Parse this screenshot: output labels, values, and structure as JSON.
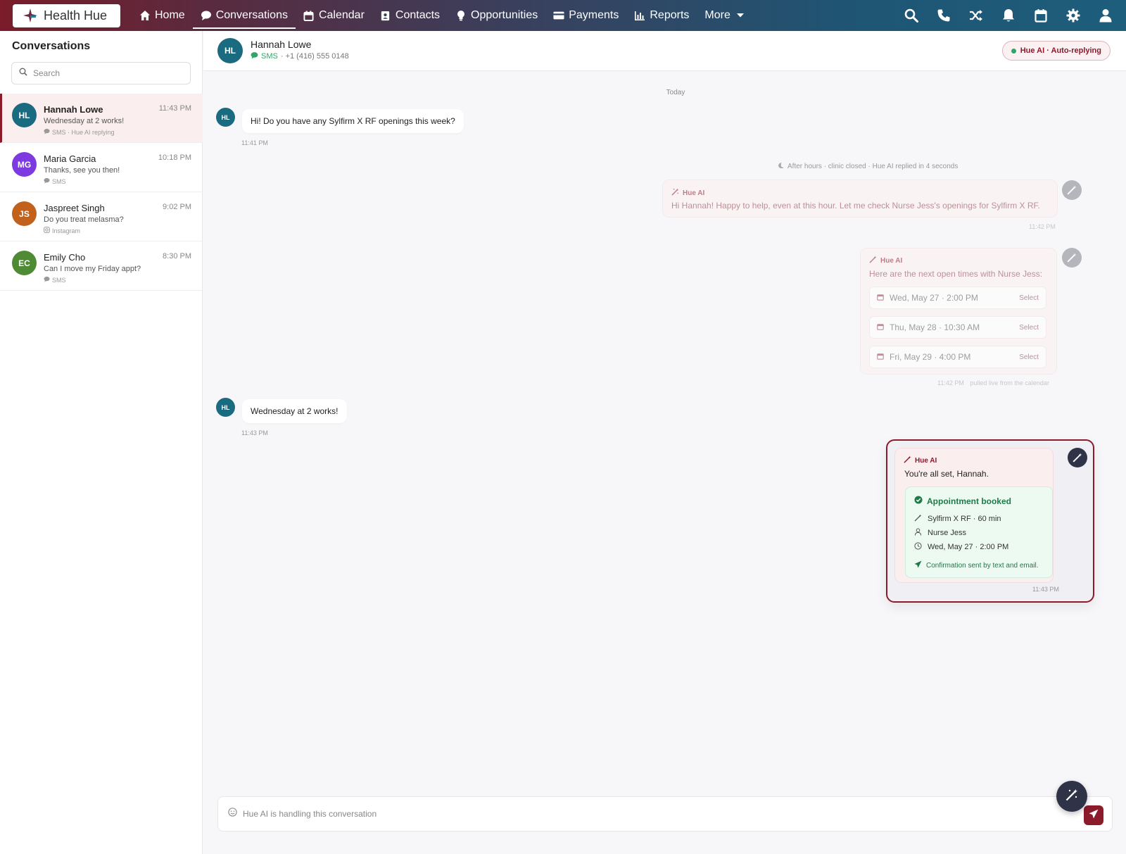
{
  "brand": {
    "name": "Health Hue"
  },
  "nav": {
    "items": [
      {
        "label": "Home",
        "icon": "home-icon",
        "active": false
      },
      {
        "label": "Conversations",
        "icon": "chat-bubble-icon",
        "active": true
      },
      {
        "label": "Calendar",
        "icon": "calendar-icon",
        "active": false
      },
      {
        "label": "Contacts",
        "icon": "contact-card-icon",
        "active": false
      },
      {
        "label": "Opportunities",
        "icon": "lightbulb-icon",
        "active": false
      },
      {
        "label": "Payments",
        "icon": "credit-card-icon",
        "active": false
      },
      {
        "label": "Reports",
        "icon": "bar-chart-icon",
        "active": false
      },
      {
        "label": "More",
        "icon": "chevron-down-icon",
        "active": false
      }
    ],
    "right_icons": [
      "search-icon",
      "phone-icon",
      "shuffle-icon",
      "bell-icon",
      "calendar-icon",
      "gear-icon",
      "user-icon"
    ]
  },
  "sidebar": {
    "title": "Conversations",
    "search_placeholder": "Search",
    "conversations": [
      {
        "initials": "HL",
        "name": "Hannah Lowe",
        "time": "11:43 PM",
        "preview": "Wednesday at 2 works!",
        "meta": "SMS · Hue AI replying",
        "color": "#1a6a80",
        "active": true
      },
      {
        "initials": "MG",
        "name": "Maria Garcia",
        "time": "10:18 PM",
        "preview": "Thanks, see you then!",
        "meta": "SMS",
        "color": "#7c3ae0",
        "active": false
      },
      {
        "initials": "JS",
        "name": "Jaspreet Singh",
        "time": "9:02 PM",
        "preview": "Do you treat melasma?",
        "meta": "Instagram",
        "color": "#c2611b",
        "active": false
      },
      {
        "initials": "EC",
        "name": "Emily Cho",
        "time": "8:30 PM",
        "preview": "Can I move my Friday appt?",
        "meta": "SMS",
        "color": "#4f8a35",
        "active": false
      }
    ]
  },
  "chat": {
    "contact_initials": "HL",
    "contact_name": "Hannah Lowe",
    "channel": "SMS",
    "phone": "· +1 (416) 555 0148",
    "ai_status": "Hue AI · Auto-replying",
    "day_label": "Today",
    "msg1": {
      "text": "Hi! Do you have any Sylfirm X RF openings this week?",
      "time": "11:41 PM"
    },
    "system_note": "After hours · clinic closed · Hue AI replied in 4 seconds",
    "ai1": {
      "label": "Hue AI",
      "text": "Hi Hannah! Happy to help, even at this hour. Let me check Nurse Jess's openings for Sylfirm X RF.",
      "time": "11:42 PM"
    },
    "ai2": {
      "label": "Hue AI",
      "text": "Here are the next open times with Nurse Jess:",
      "slots": [
        {
          "text": "Wed, May 27 · 2:00 PM",
          "action": "Select"
        },
        {
          "text": "Thu, May 28 · 10:30 AM",
          "action": "Select"
        },
        {
          "text": "Fri, May 29 · 4:00 PM",
          "action": "Select"
        }
      ],
      "time": "11:42 PM",
      "footnote": "pulled live from the calendar"
    },
    "msg2": {
      "text": "Wednesday at 2 works!",
      "time": "11:43 PM"
    },
    "ai3": {
      "label": "Hue AI",
      "text": "You're all set, Hannah.",
      "booked_title": "Appointment booked",
      "service": "Sylfirm X RF · 60 min",
      "provider": "Nurse Jess",
      "datetime": "Wed, May 27 · 2:00 PM",
      "confirmation": "Confirmation sent by text and email.",
      "time": "11:43 PM"
    },
    "composer_placeholder": "Hue AI is handling this conversation"
  },
  "colors": {
    "brand": "#8b1a2b",
    "success": "#2ea66a",
    "teal": "#1a6a80"
  }
}
